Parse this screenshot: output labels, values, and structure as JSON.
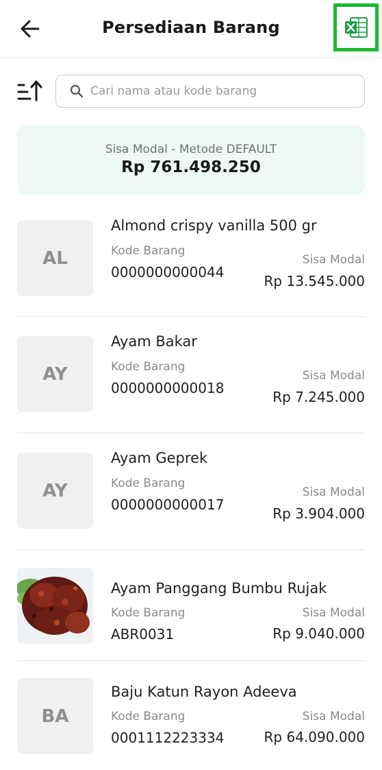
{
  "header": {
    "title": "Persediaan Barang",
    "back_icon": "arrow-left-icon",
    "export_icon": "excel-icon",
    "export_color": "#19b82f"
  },
  "search": {
    "placeholder": "Cari nama atau kode barang",
    "value": ""
  },
  "summary": {
    "label": "Sisa Modal - Metode DEFAULT",
    "value": "Rp 761.498.250",
    "background": "#eef9f4"
  },
  "labels": {
    "code": "Kode Barang",
    "modal": "Sisa Modal"
  },
  "items": [
    {
      "initials": "AL",
      "name": "Almond crispy vanilla 500 gr",
      "code": "0000000000044",
      "modal": "Rp 13.545.000",
      "has_image": false
    },
    {
      "initials": "AY",
      "name": "Ayam Bakar",
      "code": "0000000000018",
      "modal": "Rp 7.245.000",
      "has_image": false
    },
    {
      "initials": "AY",
      "name": "Ayam Geprek",
      "code": "0000000000017",
      "modal": "Rp 3.904.000",
      "has_image": false
    },
    {
      "initials": "",
      "name": "Ayam Panggang Bumbu Rujak",
      "code": "ABR0031",
      "modal": "Rp 9.040.000",
      "has_image": true
    },
    {
      "initials": "BA",
      "name": "Baju Katun Rayon Adeeva",
      "code": "0001112223334",
      "modal": "Rp 64.090.000",
      "has_image": false
    }
  ]
}
